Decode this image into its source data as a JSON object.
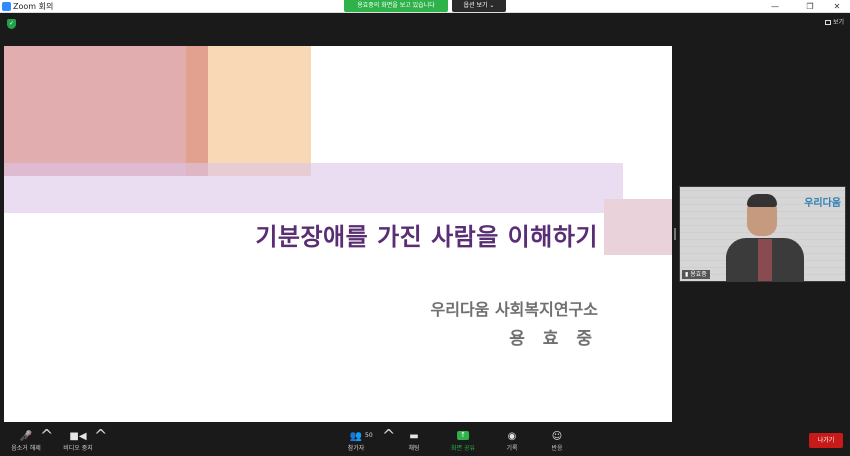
{
  "window": {
    "title": "Zoom 회의",
    "minimize": "—",
    "maximize": "❐",
    "close": "✕"
  },
  "share": {
    "banner": "용효중의 화면을 보고 있습니다",
    "view_options": "옵션 보기 ⌄"
  },
  "view_button": "보기",
  "slide": {
    "title": "기분장애를 가진 사람을 이해하기",
    "organization": "우리다움 사회복지연구소",
    "presenter": "용 효 중"
  },
  "video": {
    "name": "용효중",
    "logo": "우리다움"
  },
  "toolbar": {
    "mute": "음소거 해제",
    "video": "비디오 중지",
    "participants": "참가자",
    "participants_count": "50",
    "chat": "채팅",
    "share": "화면 공유",
    "record": "기록",
    "reactions": "반응",
    "leave": "나가기"
  },
  "icons": {
    "mute": "mic-muted-icon",
    "video": "video-camera-icon",
    "participants": "participants-icon",
    "chat": "chat-icon",
    "share": "share-screen-icon",
    "record": "record-icon",
    "reactions": "reaction-icon"
  },
  "colors": {
    "accent_green": "#2fb24a",
    "leave_red": "#c91a1a",
    "slide_title": "#5a2e74"
  }
}
